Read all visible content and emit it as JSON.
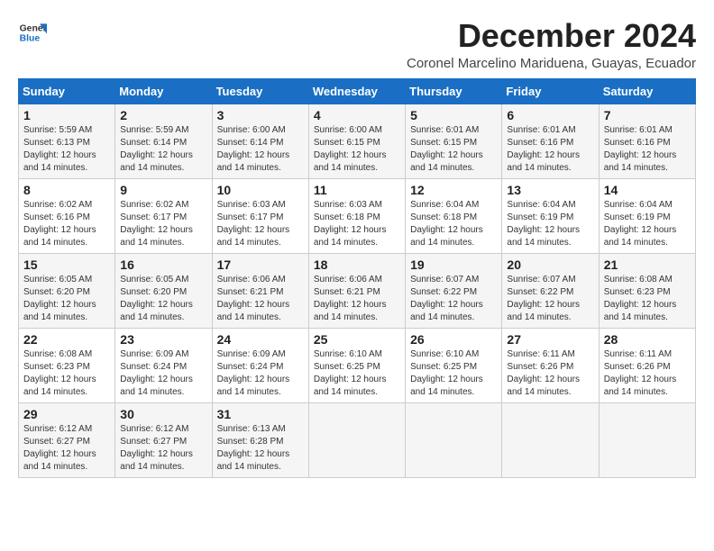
{
  "header": {
    "logo_line1": "General",
    "logo_line2": "Blue",
    "month_title": "December 2024",
    "location": "Coronel Marcelino Mariduena, Guayas, Ecuador"
  },
  "days_of_week": [
    "Sunday",
    "Monday",
    "Tuesday",
    "Wednesday",
    "Thursday",
    "Friday",
    "Saturday"
  ],
  "weeks": [
    [
      {
        "day": "1",
        "info": "Sunrise: 5:59 AM\nSunset: 6:13 PM\nDaylight: 12 hours and 14 minutes."
      },
      {
        "day": "2",
        "info": "Sunrise: 5:59 AM\nSunset: 6:14 PM\nDaylight: 12 hours and 14 minutes."
      },
      {
        "day": "3",
        "info": "Sunrise: 6:00 AM\nSunset: 6:14 PM\nDaylight: 12 hours and 14 minutes."
      },
      {
        "day": "4",
        "info": "Sunrise: 6:00 AM\nSunset: 6:15 PM\nDaylight: 12 hours and 14 minutes."
      },
      {
        "day": "5",
        "info": "Sunrise: 6:01 AM\nSunset: 6:15 PM\nDaylight: 12 hours and 14 minutes."
      },
      {
        "day": "6",
        "info": "Sunrise: 6:01 AM\nSunset: 6:16 PM\nDaylight: 12 hours and 14 minutes."
      },
      {
        "day": "7",
        "info": "Sunrise: 6:01 AM\nSunset: 6:16 PM\nDaylight: 12 hours and 14 minutes."
      }
    ],
    [
      {
        "day": "8",
        "info": "Sunrise: 6:02 AM\nSunset: 6:16 PM\nDaylight: 12 hours and 14 minutes."
      },
      {
        "day": "9",
        "info": "Sunrise: 6:02 AM\nSunset: 6:17 PM\nDaylight: 12 hours and 14 minutes."
      },
      {
        "day": "10",
        "info": "Sunrise: 6:03 AM\nSunset: 6:17 PM\nDaylight: 12 hours and 14 minutes."
      },
      {
        "day": "11",
        "info": "Sunrise: 6:03 AM\nSunset: 6:18 PM\nDaylight: 12 hours and 14 minutes."
      },
      {
        "day": "12",
        "info": "Sunrise: 6:04 AM\nSunset: 6:18 PM\nDaylight: 12 hours and 14 minutes."
      },
      {
        "day": "13",
        "info": "Sunrise: 6:04 AM\nSunset: 6:19 PM\nDaylight: 12 hours and 14 minutes."
      },
      {
        "day": "14",
        "info": "Sunrise: 6:04 AM\nSunset: 6:19 PM\nDaylight: 12 hours and 14 minutes."
      }
    ],
    [
      {
        "day": "15",
        "info": "Sunrise: 6:05 AM\nSunset: 6:20 PM\nDaylight: 12 hours and 14 minutes."
      },
      {
        "day": "16",
        "info": "Sunrise: 6:05 AM\nSunset: 6:20 PM\nDaylight: 12 hours and 14 minutes."
      },
      {
        "day": "17",
        "info": "Sunrise: 6:06 AM\nSunset: 6:21 PM\nDaylight: 12 hours and 14 minutes."
      },
      {
        "day": "18",
        "info": "Sunrise: 6:06 AM\nSunset: 6:21 PM\nDaylight: 12 hours and 14 minutes."
      },
      {
        "day": "19",
        "info": "Sunrise: 6:07 AM\nSunset: 6:22 PM\nDaylight: 12 hours and 14 minutes."
      },
      {
        "day": "20",
        "info": "Sunrise: 6:07 AM\nSunset: 6:22 PM\nDaylight: 12 hours and 14 minutes."
      },
      {
        "day": "21",
        "info": "Sunrise: 6:08 AM\nSunset: 6:23 PM\nDaylight: 12 hours and 14 minutes."
      }
    ],
    [
      {
        "day": "22",
        "info": "Sunrise: 6:08 AM\nSunset: 6:23 PM\nDaylight: 12 hours and 14 minutes."
      },
      {
        "day": "23",
        "info": "Sunrise: 6:09 AM\nSunset: 6:24 PM\nDaylight: 12 hours and 14 minutes."
      },
      {
        "day": "24",
        "info": "Sunrise: 6:09 AM\nSunset: 6:24 PM\nDaylight: 12 hours and 14 minutes."
      },
      {
        "day": "25",
        "info": "Sunrise: 6:10 AM\nSunset: 6:25 PM\nDaylight: 12 hours and 14 minutes."
      },
      {
        "day": "26",
        "info": "Sunrise: 6:10 AM\nSunset: 6:25 PM\nDaylight: 12 hours and 14 minutes."
      },
      {
        "day": "27",
        "info": "Sunrise: 6:11 AM\nSunset: 6:26 PM\nDaylight: 12 hours and 14 minutes."
      },
      {
        "day": "28",
        "info": "Sunrise: 6:11 AM\nSunset: 6:26 PM\nDaylight: 12 hours and 14 minutes."
      }
    ],
    [
      {
        "day": "29",
        "info": "Sunrise: 6:12 AM\nSunset: 6:27 PM\nDaylight: 12 hours and 14 minutes."
      },
      {
        "day": "30",
        "info": "Sunrise: 6:12 AM\nSunset: 6:27 PM\nDaylight: 12 hours and 14 minutes."
      },
      {
        "day": "31",
        "info": "Sunrise: 6:13 AM\nSunset: 6:28 PM\nDaylight: 12 hours and 14 minutes."
      },
      {
        "day": "",
        "info": ""
      },
      {
        "day": "",
        "info": ""
      },
      {
        "day": "",
        "info": ""
      },
      {
        "day": "",
        "info": ""
      }
    ]
  ]
}
